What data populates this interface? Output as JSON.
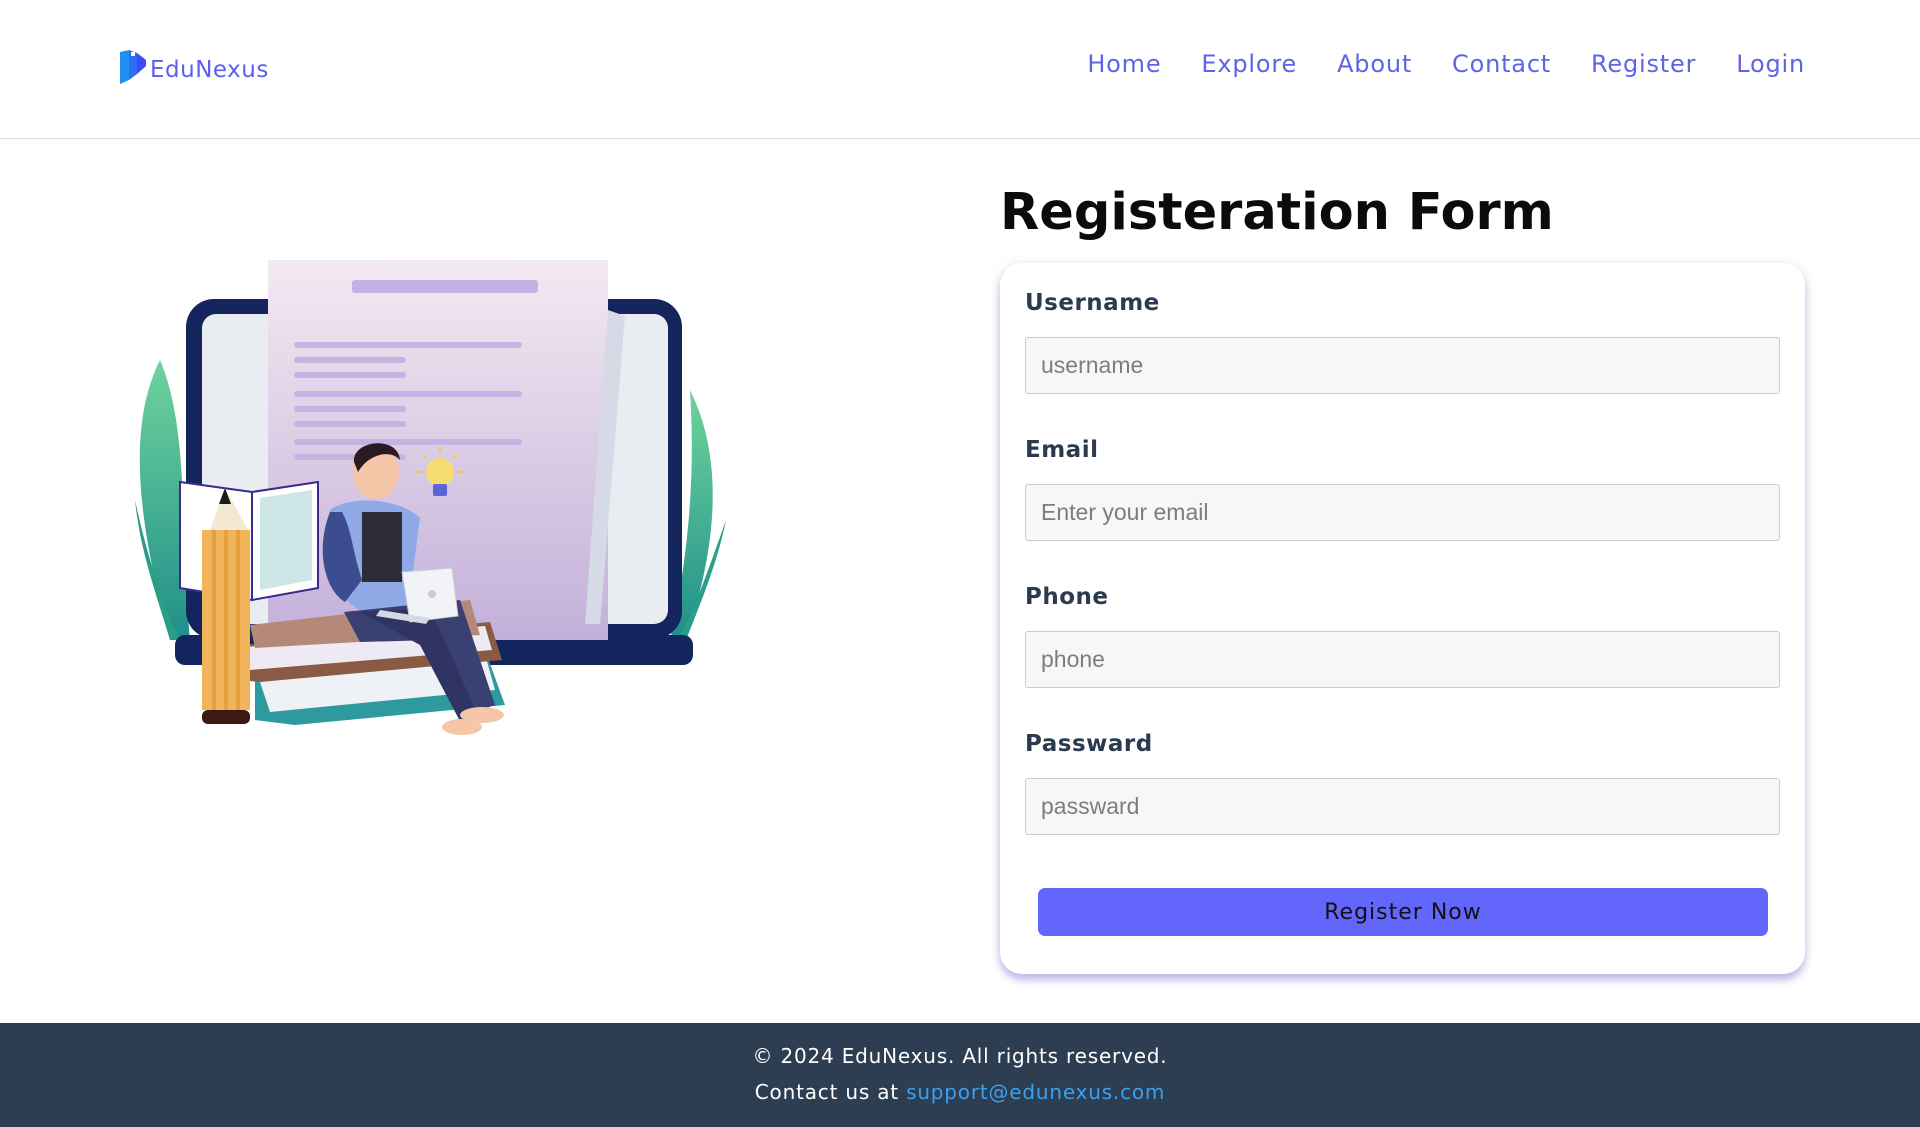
{
  "brand": {
    "name": "EduNexus",
    "logo_icon": "book-flag-icon"
  },
  "nav": {
    "items": [
      {
        "label": "Home"
      },
      {
        "label": "Explore"
      },
      {
        "label": "About"
      },
      {
        "label": "Contact"
      },
      {
        "label": "Register"
      },
      {
        "label": "Login"
      }
    ]
  },
  "form": {
    "title": "Registeration Form",
    "fields": [
      {
        "label": "Username",
        "placeholder": "username",
        "value": ""
      },
      {
        "label": "Email",
        "placeholder": "Enter your email",
        "value": ""
      },
      {
        "label": "Phone",
        "placeholder": "phone",
        "value": ""
      },
      {
        "label": "Passward",
        "placeholder": "passward",
        "value": ""
      }
    ],
    "submit_label": "Register Now"
  },
  "footer": {
    "copyright": "© 2024 EduNexus. All rights reserved.",
    "contact_prefix": "Contact us at",
    "contact_email": "support@edunexus.com"
  },
  "colors": {
    "accent": "#6266fb",
    "nav_link": "#5f63e6",
    "footer_bg": "#2d3d52",
    "footer_link": "#3aa0f0"
  }
}
